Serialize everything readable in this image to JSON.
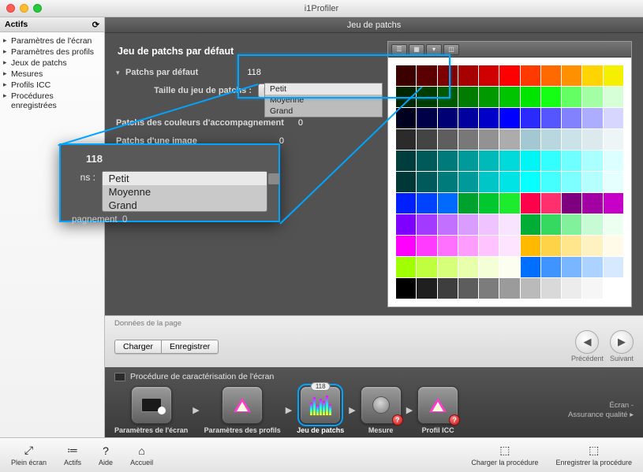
{
  "app": {
    "title": "i1Profiler"
  },
  "sidebar": {
    "header": "Actifs",
    "items": [
      "Paramètres de l'écran",
      "Paramètres des profils",
      "Jeux de patchs",
      "Mesures",
      "Profils ICC",
      "Procédures enregistrées"
    ]
  },
  "content": {
    "header": "Jeu de patchs",
    "panel_title": "Jeu de patchs par défaut",
    "rows": {
      "default_label": "Patchs par défaut",
      "default_value": "118",
      "size_label": "Taille du jeu de patchs :",
      "accomp_label": "Patchs des couleurs d'accompagnement",
      "accomp_value": "0",
      "image_label": "Patchs d'une image",
      "image_value": "0"
    },
    "dropdown": {
      "options": [
        "Petit",
        "Moyenne",
        "Grand"
      ],
      "selected": "Petit"
    }
  },
  "zoom": {
    "value": "118",
    "left_label": "ns :",
    "options": [
      "Petit",
      "Moyenne",
      "Grand"
    ],
    "bottom_label": "pagnement",
    "bottom_value": "0"
  },
  "preview": {
    "toolbar_icons": [
      "list-icon",
      "grid-icon",
      "arrow-down-icon",
      "window-icon"
    ],
    "rows": [
      [
        "#3b0000",
        "#5b0000",
        "#7e0000",
        "#a70000",
        "#d00000",
        "#ff0000",
        "#ff3a00",
        "#ff6a00",
        "#ff9100",
        "#ffd400",
        "#f5ef00"
      ],
      [
        "#002600",
        "#003d00",
        "#005a00",
        "#007c00",
        "#009a00",
        "#00c400",
        "#00e500",
        "#15ff15",
        "#63ff63",
        "#a3ffa3",
        "#d7ffd7"
      ],
      [
        "#00001f",
        "#000049",
        "#000074",
        "#00009f",
        "#0000c9",
        "#0000ff",
        "#2a2aff",
        "#5656ff",
        "#8282ff",
        "#adadff",
        "#d6d6ff"
      ],
      [
        "#2b2b2b",
        "#444444",
        "#5e5e5e",
        "#787878",
        "#929292",
        "#acacac",
        "#a3c8d1",
        "#b8d7de",
        "#cbe2e8",
        "#dceaee",
        "#eef5f7"
      ],
      [
        "#003d3d",
        "#005a5a",
        "#007a7a",
        "#009a9a",
        "#00baba",
        "#00dada",
        "#00f5f5",
        "#33ffff",
        "#70ffff",
        "#aaffff",
        "#dcffff"
      ],
      [
        "#003838",
        "#00595a",
        "#007b7b",
        "#009a9b",
        "#00c6c7",
        "#00e4e5",
        "#07ffff",
        "#45ffff",
        "#7effff",
        "#b5ffff",
        "#e5ffff"
      ],
      [
        "#001fff",
        "#0043ff",
        "#006aff",
        "#00a22e",
        "#00c82e",
        "#1dec2e",
        "#ff004b",
        "#ff306d",
        "#7e007e",
        "#a300a3",
        "#c700c7"
      ],
      [
        "#7e00ff",
        "#a23bff",
        "#c170ff",
        "#d99cff",
        "#eec3ff",
        "#f9e4ff",
        "#00ad36",
        "#35d95f",
        "#82f19c",
        "#c6fbd4",
        "#ecfff1"
      ],
      [
        "#ff00ff",
        "#ff3bff",
        "#ff70ff",
        "#ff9cff",
        "#ffc3ff",
        "#ffe4ff",
        "#ffba00",
        "#ffd347",
        "#ffe58b",
        "#fff2c2",
        "#fffbe8"
      ],
      [
        "#a0ff00",
        "#c0ff3f",
        "#d6ff7a",
        "#e8ffac",
        "#f4ffd7",
        "#fcfff0",
        "#006eff",
        "#3f94ff",
        "#7ab5ff",
        "#acd2ff",
        "#d7e9ff"
      ],
      [
        "#000000",
        "#1f1f1f",
        "#3e3e3e",
        "#5d5d5d",
        "#7c7c7c",
        "#9b9b9b",
        "#bababa",
        "#d9d9d9",
        "#ececec",
        "#f6f6f6",
        "#ffffff"
      ]
    ]
  },
  "page_footer": {
    "label": "Données de la page",
    "load": "Charger",
    "save": "Enregistrer",
    "prev": "Précédent",
    "next": "Suivant"
  },
  "workflow": {
    "title": "Procédure de caractérisation de l'écran",
    "badge": "118",
    "steps": [
      "Paramètres de l'écran",
      "Paramètres des profils",
      "Jeu de patchs",
      "Mesure",
      "Profil ICC"
    ],
    "right1": "Écran -",
    "right2": "Assurance qualité",
    "right_arrow": "▸"
  },
  "toolbar": {
    "items_left": [
      {
        "icon": "⤢",
        "label": "Plein écran"
      },
      {
        "icon": "≔",
        "label": "Actifs"
      },
      {
        "icon": "?",
        "label": "Aide"
      },
      {
        "icon": "⌂",
        "label": "Accueil"
      }
    ],
    "items_right": [
      {
        "icon": "⬚",
        "label": "Charger la procédure"
      },
      {
        "icon": "⬚",
        "label": "Enregistrer la procédure"
      }
    ]
  }
}
